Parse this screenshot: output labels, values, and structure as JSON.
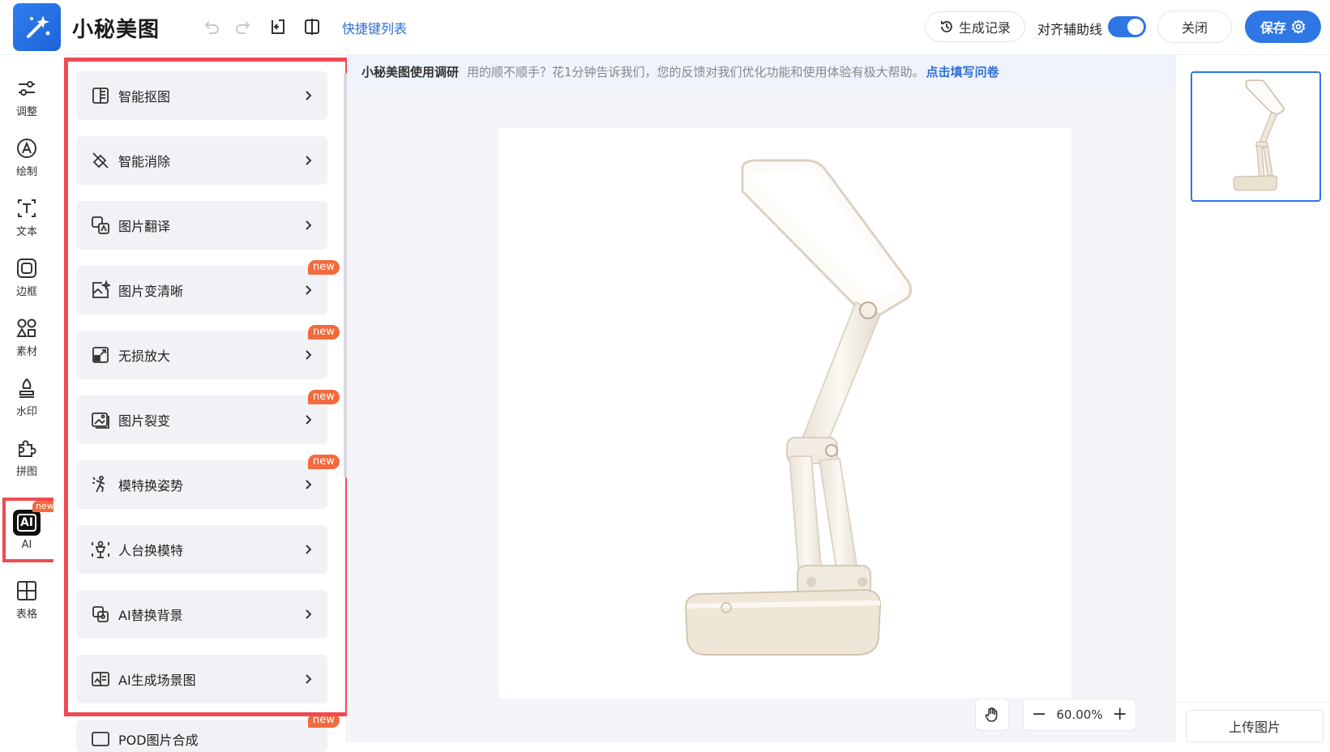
{
  "app": {
    "title": "小秘美图",
    "logo_icon": "magic-wand-icon"
  },
  "toolbar": {
    "shortcut_link": "快捷键列表",
    "history_label": "生成记录",
    "align_label": "对齐辅助线",
    "align_enabled": true,
    "close_label": "关闭",
    "save_label": "保存"
  },
  "nav": {
    "items": [
      {
        "label": "调整",
        "icon": "sliders-icon"
      },
      {
        "label": "绘制",
        "icon": "pen-icon"
      },
      {
        "label": "文本",
        "icon": "text-icon"
      },
      {
        "label": "边框",
        "icon": "frame-icon"
      },
      {
        "label": "素材",
        "icon": "shapes-icon"
      },
      {
        "label": "水印",
        "icon": "stamp-icon"
      },
      {
        "label": "拼图",
        "icon": "puzzle-icon"
      },
      {
        "label": "AI",
        "icon": "ai-icon",
        "badge": "new",
        "active": true
      },
      {
        "label": "表格",
        "icon": "table-icon"
      }
    ]
  },
  "panel": {
    "items": [
      {
        "label": "智能抠图",
        "icon": "cutout-icon"
      },
      {
        "label": "智能消除",
        "icon": "eraser-icon"
      },
      {
        "label": "图片翻译",
        "icon": "translate-icon"
      },
      {
        "label": "图片变清晰",
        "icon": "enhance-icon",
        "badge": "new"
      },
      {
        "label": "无损放大",
        "icon": "upscale-icon",
        "badge": "new"
      },
      {
        "label": "图片裂变",
        "icon": "image-variant-icon",
        "badge": "new"
      },
      {
        "label": "模特换姿势",
        "icon": "pose-icon",
        "badge": "new"
      },
      {
        "label": "人台换模特",
        "icon": "mannequin-icon"
      },
      {
        "label": "AI替换背景",
        "icon": "background-icon"
      },
      {
        "label": "AI生成场景图",
        "icon": "scene-icon"
      },
      {
        "label": "POD图片合成",
        "icon": "pod-icon",
        "badge": "new"
      }
    ]
  },
  "survey": {
    "title": "小秘美图使用调研",
    "text": "用的顺不顺手？花1分钟告诉我们，您的反馈对我们优化功能和使用体验有极大帮助。",
    "link": "点击填写问卷"
  },
  "canvas": {
    "zoom": "60.00%",
    "image_subject": "white folding desk lamp"
  },
  "right": {
    "upload_label": "上传图片"
  },
  "colors": {
    "accent": "#2e77e5",
    "highlight": "#f04a52",
    "badge": "#f26a3d"
  }
}
